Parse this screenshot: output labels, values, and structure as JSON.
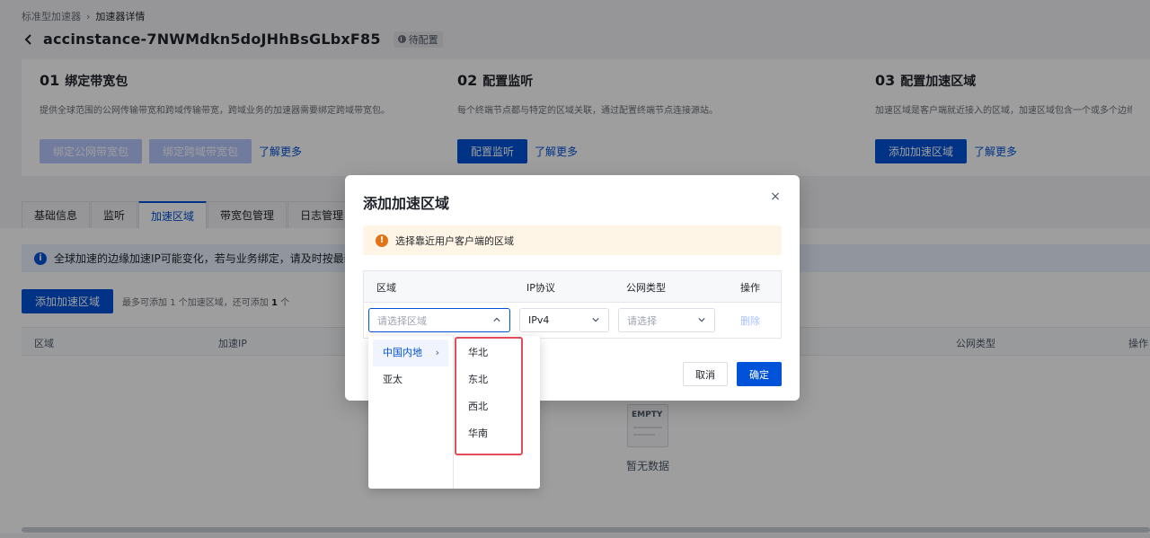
{
  "breadcrumb": {
    "parent": "标准型加速器",
    "current": "加速器详情"
  },
  "header": {
    "title": "accinstance-7NWMdkn5doJHhBsGLbxF85",
    "status": "待配置"
  },
  "steps": [
    {
      "num": "01",
      "title": "绑定带宽包",
      "desc": "提供全球范围的公网传输带宽和跨域传输带宽，跨域业务的加速器需要绑定跨域带宽包。",
      "buttons": [
        "绑定公网带宽包",
        "绑定跨域带宽包"
      ],
      "link": "了解更多"
    },
    {
      "num": "02",
      "title": "配置监听",
      "desc": "每个终端节点都与特定的区域关联，通过配置终端节点连接源站。",
      "buttons": [
        "配置监听"
      ],
      "link": "了解更多"
    },
    {
      "num": "03",
      "title": "配置加速区域",
      "desc": "加速区域是客户端就近接入的区域，加速区域包含一个或多个边缘接入点",
      "buttons": [
        "添加加速区域"
      ],
      "link": "了解更多"
    }
  ],
  "tabs": [
    "基础信息",
    "监听",
    "加速区域",
    "带宽包管理",
    "日志管理"
  ],
  "notice": "全球加速的边缘加速IP可能变化，若与业务绑定，请及时按最新IP进行更新。",
  "add_button": "添加加速区域",
  "hint_prefix": "最多可添加 1 个加速区域，还可添加",
  "hint_count": "1",
  "hint_suffix": "个",
  "table_headers": {
    "region": "区域",
    "ip": "加速IP",
    "net_type": "公网类型",
    "op": "操作"
  },
  "empty": {
    "tag": "EMPTY",
    "text": "暂无数据"
  },
  "modal": {
    "title": "添加加速区域",
    "warning": "选择靠近用户客户端的区域",
    "headers": {
      "region": "区域",
      "ip": "IP协议",
      "net": "公网类型",
      "op": "操作"
    },
    "region_placeholder": "请选择区域",
    "ip_value": "IPv4",
    "net_placeholder": "请选择",
    "delete": "删除",
    "cancel": "取消",
    "ok": "确定"
  },
  "cascader": {
    "level1": [
      "中国内地",
      "亚太"
    ],
    "level2": [
      "华北",
      "东北",
      "西北",
      "华南"
    ]
  },
  "colors": {
    "primary": "#0052d9",
    "highlight": "#e34d59",
    "warning": "#e37318"
  }
}
